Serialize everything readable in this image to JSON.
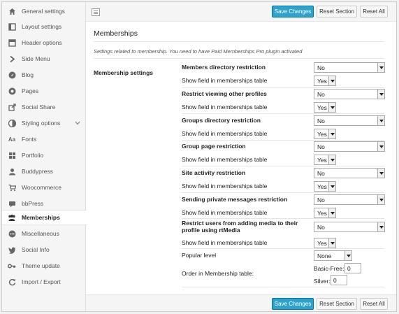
{
  "sidebar": {
    "items": [
      {
        "label": "General settings",
        "icon": "home-icon"
      },
      {
        "label": "Layout settings",
        "icon": "layout-icon"
      },
      {
        "label": "Header options",
        "icon": "header-icon"
      },
      {
        "label": "Side Menu",
        "icon": "chevron-right-icon"
      },
      {
        "label": "Blog",
        "icon": "compass-icon"
      },
      {
        "label": "Pages",
        "icon": "circle-icon"
      },
      {
        "label": "Social Share",
        "icon": "share-icon"
      },
      {
        "label": "Styling options",
        "icon": "palette-icon"
      },
      {
        "label": "Fonts",
        "icon": "font-icon"
      },
      {
        "label": "Portfolio",
        "icon": "grid-icon"
      },
      {
        "label": "Buddypress",
        "icon": "user-icon"
      },
      {
        "label": "Woocommerce",
        "icon": "cart-icon"
      },
      {
        "label": "bbPress",
        "icon": "forum-icon"
      },
      {
        "label": "Memberships",
        "icon": "group-icon"
      },
      {
        "label": "Miscellaneous",
        "icon": "misc-icon"
      },
      {
        "label": "Social Info",
        "icon": "twitter-icon"
      },
      {
        "label": "Theme update",
        "icon": "key-icon"
      },
      {
        "label": "Import / Export",
        "icon": "refresh-icon"
      }
    ]
  },
  "toolbar": {
    "save_label": "Save Changes",
    "reset_section_label": "Reset Section",
    "reset_all_label": "Reset All"
  },
  "section": {
    "title": "Memberships",
    "description": "Settings related to membership. You need to have Paid Memberships Pro plugin activated",
    "group_label": "Membership settings"
  },
  "settings": [
    {
      "label": "Members directory restriction",
      "value": "No",
      "show_label": "Show field in memberships table",
      "show_value": "Yes"
    },
    {
      "label": "Restrict viewing other profiles",
      "value": "No",
      "show_label": "Show field in memberships table",
      "show_value": "Yes"
    },
    {
      "label": "Groups directory restriction",
      "value": "No",
      "show_label": "Show field in memberships table",
      "show_value": "Yes"
    },
    {
      "label": "Group page restriction",
      "value": "No",
      "show_label": "Show field in memberships table",
      "show_value": "Yes"
    },
    {
      "label": "Site activity restriction",
      "value": "No",
      "show_label": "Show field in memberships table",
      "show_value": "Yes"
    },
    {
      "label": "Sending private messages restriction",
      "value": "No",
      "show_label": "Show field in memberships table",
      "show_value": "Yes"
    },
    {
      "label": "Restrict users from adding media to their profile using rtMedia",
      "value": "No",
      "show_label": "Show field in memberships table",
      "show_value": "Yes"
    }
  ],
  "popular_level": {
    "label": "Popular level",
    "value": "None"
  },
  "order": {
    "label": "Order in Membership table:",
    "items": [
      {
        "label": "Basic-Free:",
        "value": "0"
      },
      {
        "label": "Silver:",
        "value": "0"
      }
    ]
  }
}
